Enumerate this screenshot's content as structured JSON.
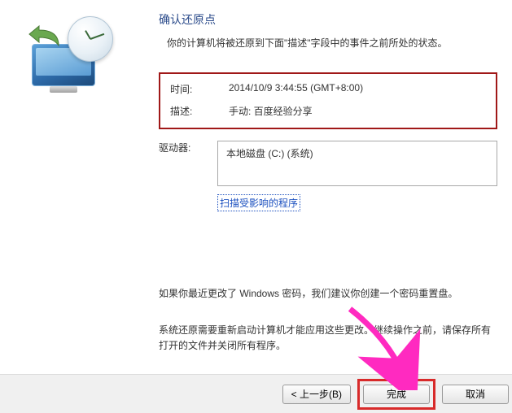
{
  "header": {
    "title": "确认还原点",
    "subtitle": "你的计算机将被还原到下面\"描述\"字段中的事件之前所处的状态。"
  },
  "details": {
    "time_label": "时间:",
    "time_value": "2014/10/9 3:44:55 (GMT+8:00)",
    "desc_label": "描述:",
    "desc_value": "手动: 百度经验分享"
  },
  "drives": {
    "label": "驱动器:",
    "items": [
      "本地磁盘 (C:) (系统)"
    ]
  },
  "scan_link": "扫描受影响的程序",
  "notes": {
    "pwd": "如果你最近更改了 Windows 密码，我们建议你创建一个密码重置盘。",
    "restart": "系统还原需要重新启动计算机才能应用这些更改。继续操作之前，请保存所有打开的文件并关闭所有程序。"
  },
  "buttons": {
    "back": "< 上一步(B)",
    "finish": "完成",
    "cancel": "取消"
  }
}
